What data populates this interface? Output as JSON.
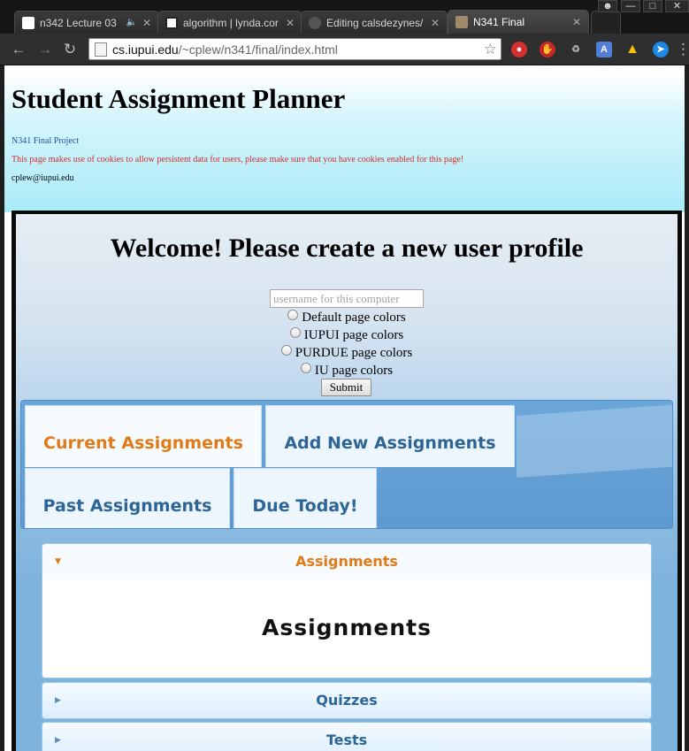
{
  "browser": {
    "tabs": [
      {
        "title": "n342 Lecture 03 |",
        "favicon": "document-icon"
      },
      {
        "title": "algorithm | lynda.cor",
        "favicon": "lynda-icon"
      },
      {
        "title": "Editing calsdezynes/",
        "favicon": "github-icon"
      },
      {
        "title": "N341 Final",
        "favicon": "owl-icon",
        "active": true
      }
    ],
    "url_host": "cs.iupui.edu",
    "url_path": "/~cplew/n341/final/index.html"
  },
  "header": {
    "title": "Student Assignment Planner",
    "subtitle": "N341 Final Project",
    "notice": "This page makes use of cookies to allow persistent data for users, please make sure that you have cookies enabled for this page!",
    "email": "cplew@iupui.edu"
  },
  "profile": {
    "heading": "Welcome! Please create a new user profile",
    "username_placeholder": "username for this computer",
    "options": [
      "Default page colors",
      "IUPUI page colors",
      "PURDUE page colors",
      "IU page colors"
    ],
    "submit_label": "Submit"
  },
  "tabs": [
    {
      "label": "Current Assignments",
      "active": true
    },
    {
      "label": "Add New Assignments",
      "active": false
    },
    {
      "label": "Past Assignments",
      "active": false
    },
    {
      "label": "Due Today!",
      "active": false
    }
  ],
  "accordion": {
    "sections": [
      {
        "label": "Assignments",
        "open": true
      },
      {
        "label": "Quizzes",
        "open": false
      },
      {
        "label": "Tests",
        "open": false
      }
    ],
    "panel_heading": "Assignments"
  },
  "colors": {
    "accent_orange": "#e07b1a",
    "tab_blue": "#2c6596",
    "header_cyan": "#a9ebf8",
    "notice_red": "#d42a2a"
  }
}
